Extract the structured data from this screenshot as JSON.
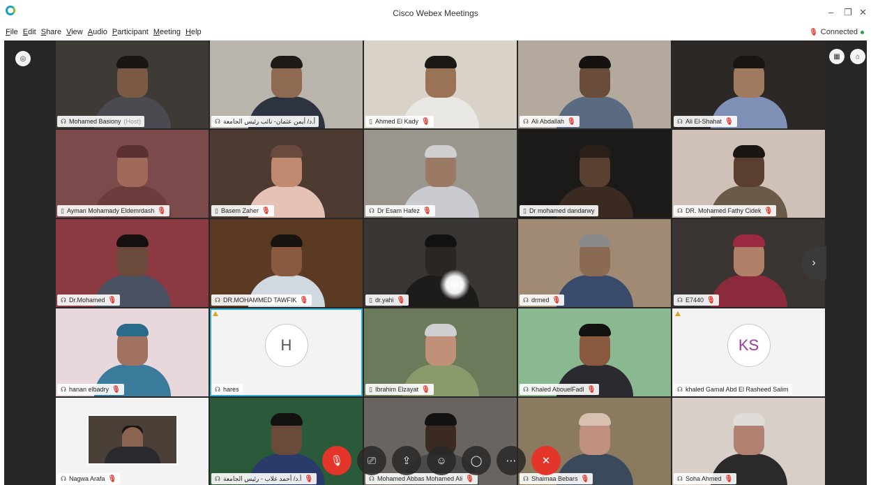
{
  "window": {
    "title": "Cisco Webex Meetings",
    "minimize": "–",
    "restore": "❐",
    "close": "✕"
  },
  "menu": [
    "File",
    "Edit",
    "Share",
    "View",
    "Audio",
    "Participant",
    "Meeting",
    "Help"
  ],
  "status": {
    "text": "Connected",
    "mic": "🎙",
    "color": "#2aa53a"
  },
  "side": {
    "left_icon": "◎",
    "grid_icon": "▦",
    "tag_icon": "⌂",
    "next": "›"
  },
  "participants": [
    {
      "name": "Mohamed Basiony",
      "role": "(Host)",
      "device": "☊",
      "muted": false,
      "bg": "#3e3a36",
      "face": "#7a5a45",
      "shirt": "#4a4a50",
      "hair": "#1a1614"
    },
    {
      "name": "أ.د/ أيمن عثمان- نائب رئيس الجامعة",
      "rtl": true,
      "device": "☊",
      "muted": false,
      "bg": "#b9b4ac",
      "face": "#8f6a52",
      "shirt": "#2d3440",
      "hair": "#201a16"
    },
    {
      "name": "Ahmed El Kady",
      "device": "▯",
      "muted": true,
      "bg": "#d8d2c8",
      "face": "#9a7357",
      "shirt": "#e9e7e3",
      "hair": "#1c1816"
    },
    {
      "name": "Ali Abdallah",
      "device": "☊",
      "muted": true,
      "bg": "#b3a99c",
      "face": "#6a4c3a",
      "shirt": "#5a6a80",
      "hair": "#15110f"
    },
    {
      "name": "Ali El-Shahat",
      "device": "☊",
      "muted": true,
      "bg": "#2c2826",
      "face": "#a07a5e",
      "shirt": "#7e90b5",
      "hair": "#1a1512"
    },
    {
      "name": "Ayman Mohamady Eldemrdash",
      "device": "▯",
      "muted": true,
      "bg": "#7b4a4a",
      "face": "#a06a5a",
      "shirt": "#6d3c3c",
      "hair": "#5a3030"
    },
    {
      "name": "Basem Zaher",
      "device": "▯",
      "muted": true,
      "bg": "#4d3a30",
      "face": "#c08a70",
      "shirt": "#e6c2b6",
      "hair": "#6a4a3e"
    },
    {
      "name": "Dr Esam Hafez",
      "device": "☊",
      "muted": true,
      "bg": "#9a968e",
      "face": "#9a7a64",
      "shirt": "#c9cbd0",
      "hair": "#cfcfcf"
    },
    {
      "name": "Dr mohamed dandarwy",
      "device": "▯",
      "muted": false,
      "bg": "#1c1a18",
      "face": "#5a4030",
      "shirt": "#3a2a20",
      "hair": "#2a1e18"
    },
    {
      "name": "DR. Mohamed Fathy Cidek",
      "device": "☊",
      "muted": true,
      "bg": "#cfc0b8",
      "face": "#5a3e30",
      "shirt": "#6a5a4a",
      "hair": "#1c1613"
    },
    {
      "name": "Dr.Mohamed",
      "device": "☊",
      "muted": true,
      "bg": "#8a3a40",
      "face": "#6a4a3a",
      "shirt": "#4a5262",
      "hair": "#141110"
    },
    {
      "name": "DR.MOHAMMED TAWFIK",
      "device": "☊",
      "muted": true,
      "bg": "#5a3a22",
      "face": "#8a5a40",
      "shirt": "#d0d8e0",
      "hair": "#1a1410"
    },
    {
      "name": "dr.yahi",
      "device": "▯",
      "muted": true,
      "bg": "#3a3634",
      "face": "#2a2624",
      "shirt": "#1e1c1a",
      "hair": "#141210",
      "glare": true
    },
    {
      "name": "drmed",
      "device": "☊",
      "muted": true,
      "bg": "#a08a74",
      "face": "#8a6a52",
      "shirt": "#3a4a6a",
      "hair": "#8a8a8a"
    },
    {
      "name": "E7440",
      "device": "☊",
      "muted": true,
      "bg": "#3a3432",
      "face": "#b08068",
      "shirt": "#8a2a3a",
      "hair": "#9a2a40"
    },
    {
      "name": "hanan elbadry",
      "device": "☊",
      "muted": true,
      "bg": "#e8d8dc",
      "face": "#a07060",
      "shirt": "#3a7a9a",
      "hair": "#2a6a8a"
    },
    {
      "name": "hares",
      "device": "☊",
      "muted": false,
      "avatar": "H",
      "active": true,
      "warning": true
    },
    {
      "name": "Ibrahim Elzayat",
      "device": "▯",
      "muted": true,
      "bg": "#6a7a5a",
      "face": "#c09078",
      "shirt": "#8a9a6a",
      "hair": "#cfcfcf"
    },
    {
      "name": "Khaled AbouelFadl",
      "device": "☊",
      "muted": true,
      "bg": "#8ab890",
      "face": "#8a5a40",
      "shirt": "#2a2a30",
      "hair": "#141210"
    },
    {
      "name": "khaled Gamal Abd El Rasheed Salim",
      "device": "☊",
      "muted": false,
      "avatar": "KS",
      "warning": true
    },
    {
      "name": "Nagwa Arafa",
      "device": "☊",
      "muted": true,
      "pip": true
    },
    {
      "name": "أ.د/ أحمد غلاب - رئيس الجامعة",
      "rtl": true,
      "device": "☊",
      "muted": true,
      "bg": "#2a5a3a",
      "face": "#6a4a38",
      "shirt": "#2a3a6a",
      "hair": "#141210"
    },
    {
      "name": "Mohamed Abbas Mohamed Ali",
      "device": "☊",
      "muted": true,
      "bg": "#6a6460",
      "face": "#3a2a22",
      "shirt": "#4a4a4a",
      "hair": "#141210"
    },
    {
      "name": "Shaimaa Bebars",
      "device": "☊",
      "muted": true,
      "bg": "#8a7a60",
      "face": "#c09080",
      "shirt": "#3a4a5a",
      "hair": "#d8c0b0"
    },
    {
      "name": "Soha Ahmed",
      "device": "☊",
      "muted": true,
      "bg": "#d8d0c8",
      "face": "#b08070",
      "shirt": "#2a2a2a",
      "hair": "#e0dcd8"
    }
  ],
  "toolbar": [
    {
      "id": "mute",
      "icon": "🎙",
      "red": true
    },
    {
      "id": "video",
      "icon": "⎚",
      "red": false
    },
    {
      "id": "share",
      "icon": "⇪",
      "red": false
    },
    {
      "id": "participants",
      "icon": "☺",
      "red": false
    },
    {
      "id": "chat",
      "icon": "◯",
      "red": false
    },
    {
      "id": "more",
      "icon": "⋯",
      "red": false
    },
    {
      "id": "leave",
      "icon": "✕",
      "red": true
    }
  ]
}
